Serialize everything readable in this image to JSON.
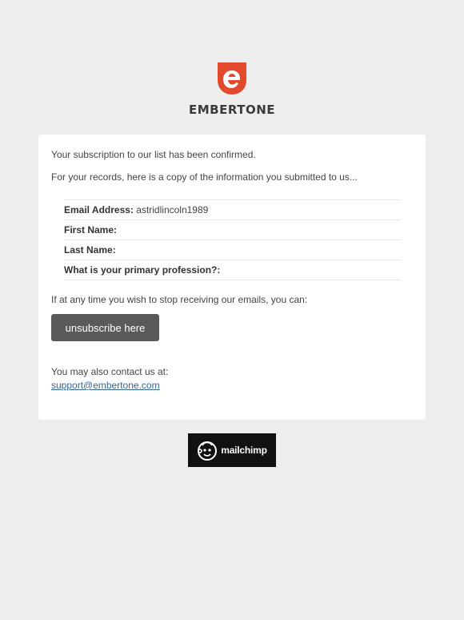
{
  "brand": {
    "name": "EMBERTONE",
    "logo_icon": "embertone-e-logo-icon",
    "logo_color": "#e24a2e"
  },
  "card": {
    "confirmation_text": "Your subscription to our list has been confirmed.",
    "records_text": "For your records, here is a copy of the information you submitted to us...",
    "fields": [
      {
        "label": "Email Address:",
        "value": "astridlincoln1989"
      },
      {
        "label": "First Name:",
        "value": ""
      },
      {
        "label": "Last Name:",
        "value": ""
      },
      {
        "label": "What is your primary profession?:",
        "value": ""
      }
    ],
    "unsubscribe_prompt": "If at any time you wish to stop receiving our emails, you can:",
    "unsubscribe_button": "unsubscribe here",
    "contact_text": "You may also contact us at:",
    "support_email": "support@embertone.com"
  },
  "footer": {
    "badge_text": "mailchimp",
    "badge_icon": "mailchimp-freddie-icon"
  }
}
